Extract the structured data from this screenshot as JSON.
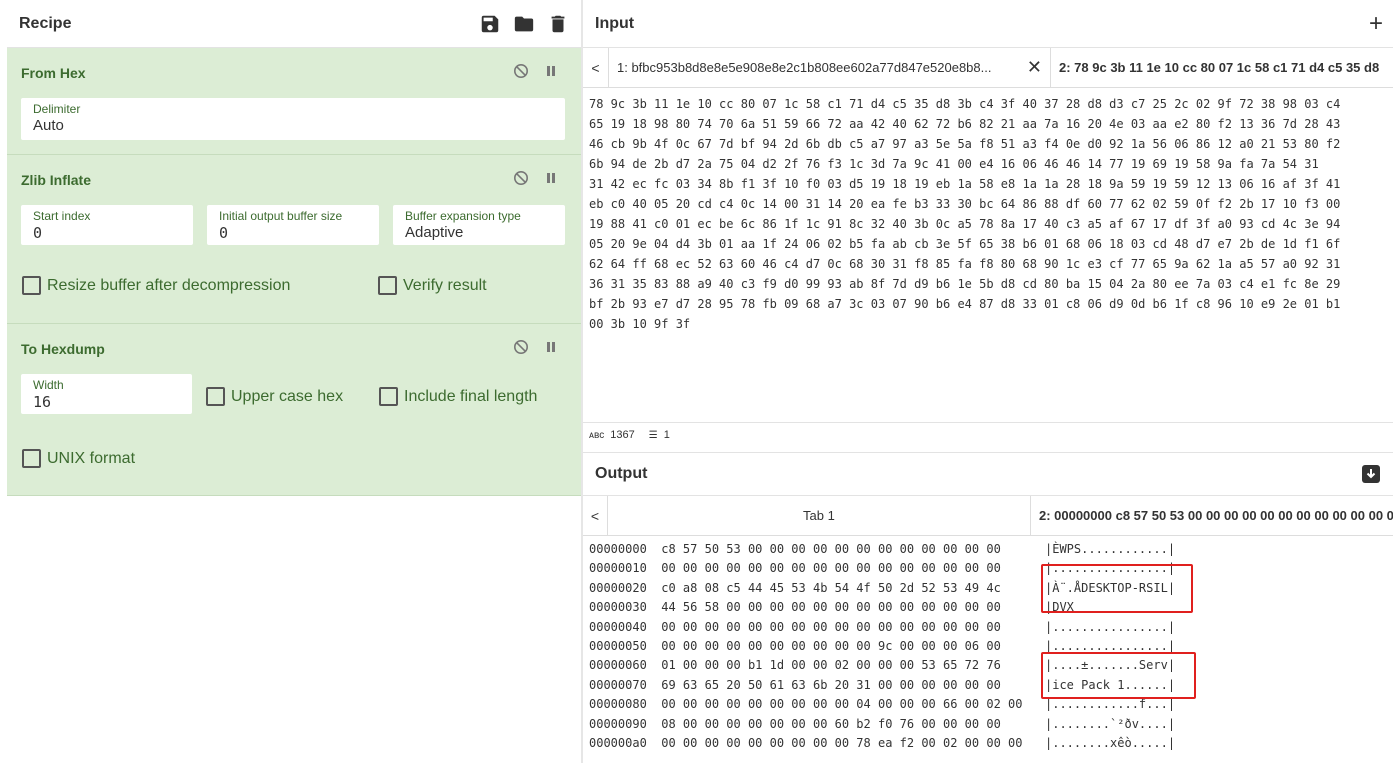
{
  "recipe": {
    "title": "Recipe",
    "icons": [
      "save-icon",
      "folder-icon",
      "trash-icon"
    ],
    "operations": [
      {
        "title": "From Hex",
        "fields": [
          {
            "label": "Delimiter",
            "value": "Auto"
          }
        ]
      },
      {
        "title": "Zlib Inflate",
        "fields": [
          {
            "label": "Start index",
            "value": "0"
          },
          {
            "label": "Initial output buffer size",
            "value": "0"
          },
          {
            "label": "Buffer expansion type",
            "value": "Adaptive"
          }
        ],
        "checkboxes": [
          "Resize buffer after decompression",
          "Verify result"
        ]
      },
      {
        "title": "To Hexdump",
        "fields": [
          {
            "label": "Width",
            "value": "16"
          }
        ],
        "checkboxes": [
          "Upper case hex",
          "Include final length",
          "UNIX format"
        ]
      }
    ]
  },
  "input": {
    "title": "Input",
    "tab1": "1: bfbc953b8d8e8e5e908e8e2c1b808ee602a77d847e520e8b8...",
    "tab2": "2: 78 9c 3b 11 1e 10 cc 80 07 1c 58 c1 71 d4 c5 35 d8",
    "lines": [
      "78 9c 3b 11 1e 10 cc 80 07 1c 58 c1 71 d4 c5 35 d8 3b c4 3f 40 37 28 d8 d3 c7 25 2c 02 9f 72 38 98 03 c4",
      "65 19 18 98 80 74 70 6a 51 59 66 72 aa 42 40 62 72 b6 82 21 aa 7a 16 20 4e 03 aa e2 80 f2 13 36 7d 28 43",
      "46 cb 9b 4f 0c 67 7d bf 94 2d 6b db c5 a7 97 a3 5e 5a f8 51 a3 f4 0e d0 92 1a 56 06 86 12 a0 21 53 80 f2",
      "6b 94 de 2b d7 2a 75 04 d2 2f 76 f3 1c 3d 7a 9c 41 00 e4 16 06 46 46 14 77 19 69 19 58 9a fa 7a 54 31",
      "31 42 ec fc 03 34 8b f1 3f 10 f0 03 d5 19 18 19 eb 1a 58 e8 1a 1a 28 18 9a 59 19 59 12 13 06 16 af 3f 41",
      "eb c0 40 05 20 cd c4 0c 14 00 31 14 20 ea fe b3 33 30 bc 64 86 88 df 60 77 62 02 59 0f f2 2b 17 10 f3 00",
      "19 88 41 c0 01 ec be 6c 86 1f 1c 91 8c 32 40 3b 0c a5 78 8a 17 40 c3 a5 af 67 17 df 3f a0 93 cd 4c 3e 94",
      "05 20 9e 04 d4 3b 01 aa 1f 24 06 02 b5 fa ab cb 3e 5f 65 38 b6 01 68 06 18 03 cd 48 d7 e7 2b de 1d f1 6f",
      "62 64 ff 68 ec 52 63 60 46 c4 d7 0c 68 30 31 f8 85 fa f8 80 68 90 1c e3 cf 77 65 9a 62 1a a5 57 a0 92 31",
      "36 31 35 83 88 a9 40 c3 f9 d0 99 93 ab 8f 7d d9 b6 1e 5b d8 cd 80 ba 15 04 2a 80 ee 7a 03 c4 e1 fc 8e 29",
      "bf 2b 93 e7 d7 28 95 78 fb 09 68 a7 3c 03 07 90 b6 e4 87 d8 33 01 c8 06 d9 0d b6 1f c8 96 10 e9 2e 01 b1",
      "00 3b 10 9f 3f"
    ],
    "status_length": "1367",
    "status_lines": "1",
    "status_icon": "abc-icon"
  },
  "output": {
    "title": "Output",
    "tab1": "Tab 1",
    "tab2": "2: 00000000 c8 57 50 53 00 00 00 00 00 00 00 00 00 00 00 00",
    "dump": [
      "00000000  c8 57 50 53 00 00 00 00 00 00 00 00 00 00 00 00",
      "00000010  00 00 00 00 00 00 00 00 00 00 00 00 00 00 00 00",
      "00000020  c0 a8 08 c5 44 45 53 4b 54 4f 50 2d 52 53 49 4c",
      "00000030  44 56 58 00 00 00 00 00 00 00 00 00 00 00 00 00",
      "00000040  00 00 00 00 00 00 00 00 00 00 00 00 00 00 00 00",
      "00000050  00 00 00 00 00 00 00 00 00 00 9c 00 00 00 06 00",
      "00000060  01 00 00 00 b1 1d 00 00 02 00 00 00 53 65 72 76",
      "00000070  69 63 65 20 50 61 63 6b 20 31 00 00 00 00 00 00",
      "00000080  00 00 00 00 00 00 00 00 00 04 00 00 00 66 00 02 00",
      "00000090  08 00 00 00 00 00 00 00 60 b2 f0 76 00 00 00 00",
      "000000a0  00 00 00 00 00 00 00 00 00 78 ea f2 00 02 00 00 00"
    ],
    "ascii": [
      "|ÈWPS............|",
      "|................|",
      "|À¨.ÅDESKTOP-RSIL|",
      "|DVX",
      "|................|",
      "|................|",
      "|....±.......Serv|",
      "|ice Pack 1......|",
      "|............f...|",
      "|........`²ðv....|",
      "|........xêò.....|"
    ]
  },
  "colors": {
    "op_bg": "#dcedd5",
    "op_text": "#3c6b2f",
    "highlight": "#e0201e"
  }
}
